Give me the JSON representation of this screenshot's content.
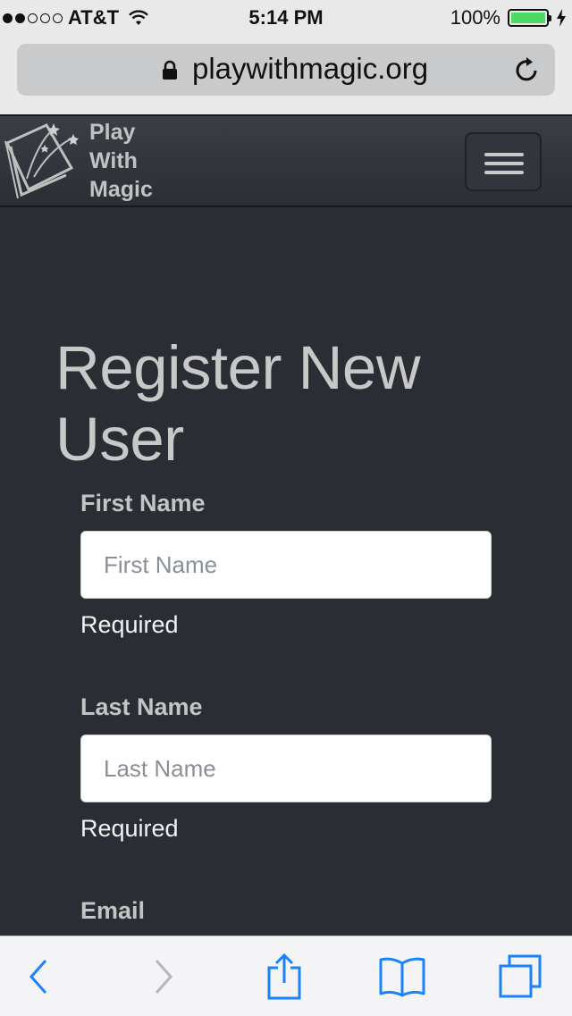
{
  "status_bar": {
    "carrier": "AT&T",
    "time": "5:14 PM",
    "battery_percent": "100%",
    "signal_strength_dots": 2,
    "icons": [
      "wifi-icon",
      "battery-icon",
      "charging-bolt-icon"
    ]
  },
  "browser": {
    "url": "playwithmagic.org",
    "icons": [
      "lock-icon",
      "reload-icon"
    ]
  },
  "navbar": {
    "brand_line1": "Play",
    "brand_line2": "With",
    "brand_line3": "Magic",
    "icons": [
      "book-logo-icon",
      "hamburger-menu-icon"
    ]
  },
  "page": {
    "title": "Register New User",
    "fields": [
      {
        "label": "First Name",
        "placeholder": "First Name",
        "value": "",
        "help": "Required"
      },
      {
        "label": "Last Name",
        "placeholder": "Last Name",
        "value": "",
        "help": "Required"
      },
      {
        "label": "Email"
      }
    ]
  },
  "toolbar": {
    "icons": [
      "back-icon",
      "forward-icon",
      "share-icon",
      "bookmarks-icon",
      "tabs-icon"
    ]
  },
  "colors": {
    "page_background": "#2a2d33",
    "accent_blue": "#1a82fb",
    "battery_green": "#4cd964"
  }
}
